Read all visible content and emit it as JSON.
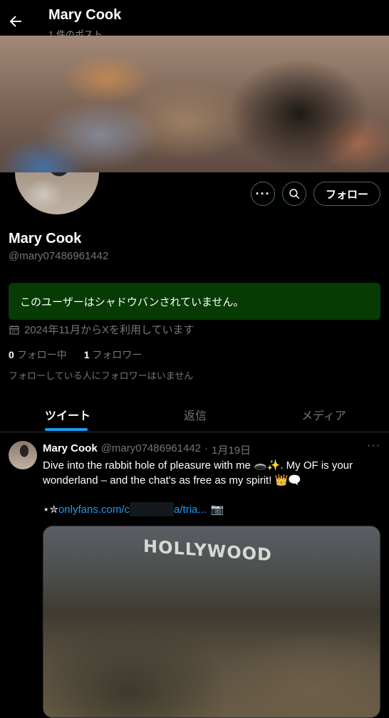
{
  "header": {
    "title": "Mary Cook",
    "subtitle": "1 件のポスト"
  },
  "profile": {
    "name": "Mary Cook",
    "handle": "@mary07486961442",
    "follow_label": "フォロー",
    "more_label": "···",
    "shadowban_status": "このユーザーはシャドウバンされていません。",
    "joined": "2024年11月からXを利用しています",
    "following_count": "0",
    "following_label": "フォロー中",
    "followers_count": "1",
    "followers_label": "フォロワー",
    "mutual_note": "フォローしている人にフォロワーはいません",
    "shadowban_color": "#063b03"
  },
  "tabs": [
    {
      "label": "ツイート",
      "active": true
    },
    {
      "label": "返信",
      "active": false
    },
    {
      "label": "メディア",
      "active": false
    }
  ],
  "tweet": {
    "author": "Mary Cook",
    "handle": "@mary07486961442",
    "separator": "·",
    "date": "1月19日",
    "more_label": "···",
    "text": "Dive into the rabbit hole of pleasure with me 🕳️✨. My OF is your wonderland – and the chat's as free as my spirit! 👑🗨️",
    "link_prefix": "⋆✮",
    "link_start": "onlyfans.com/c",
    "link_end": "a/tria...",
    "link_suffix": "📷",
    "image_sign_text": "HOLLYWOOD"
  },
  "colors": {
    "accent": "#1d9bf0",
    "background": "#000000"
  }
}
